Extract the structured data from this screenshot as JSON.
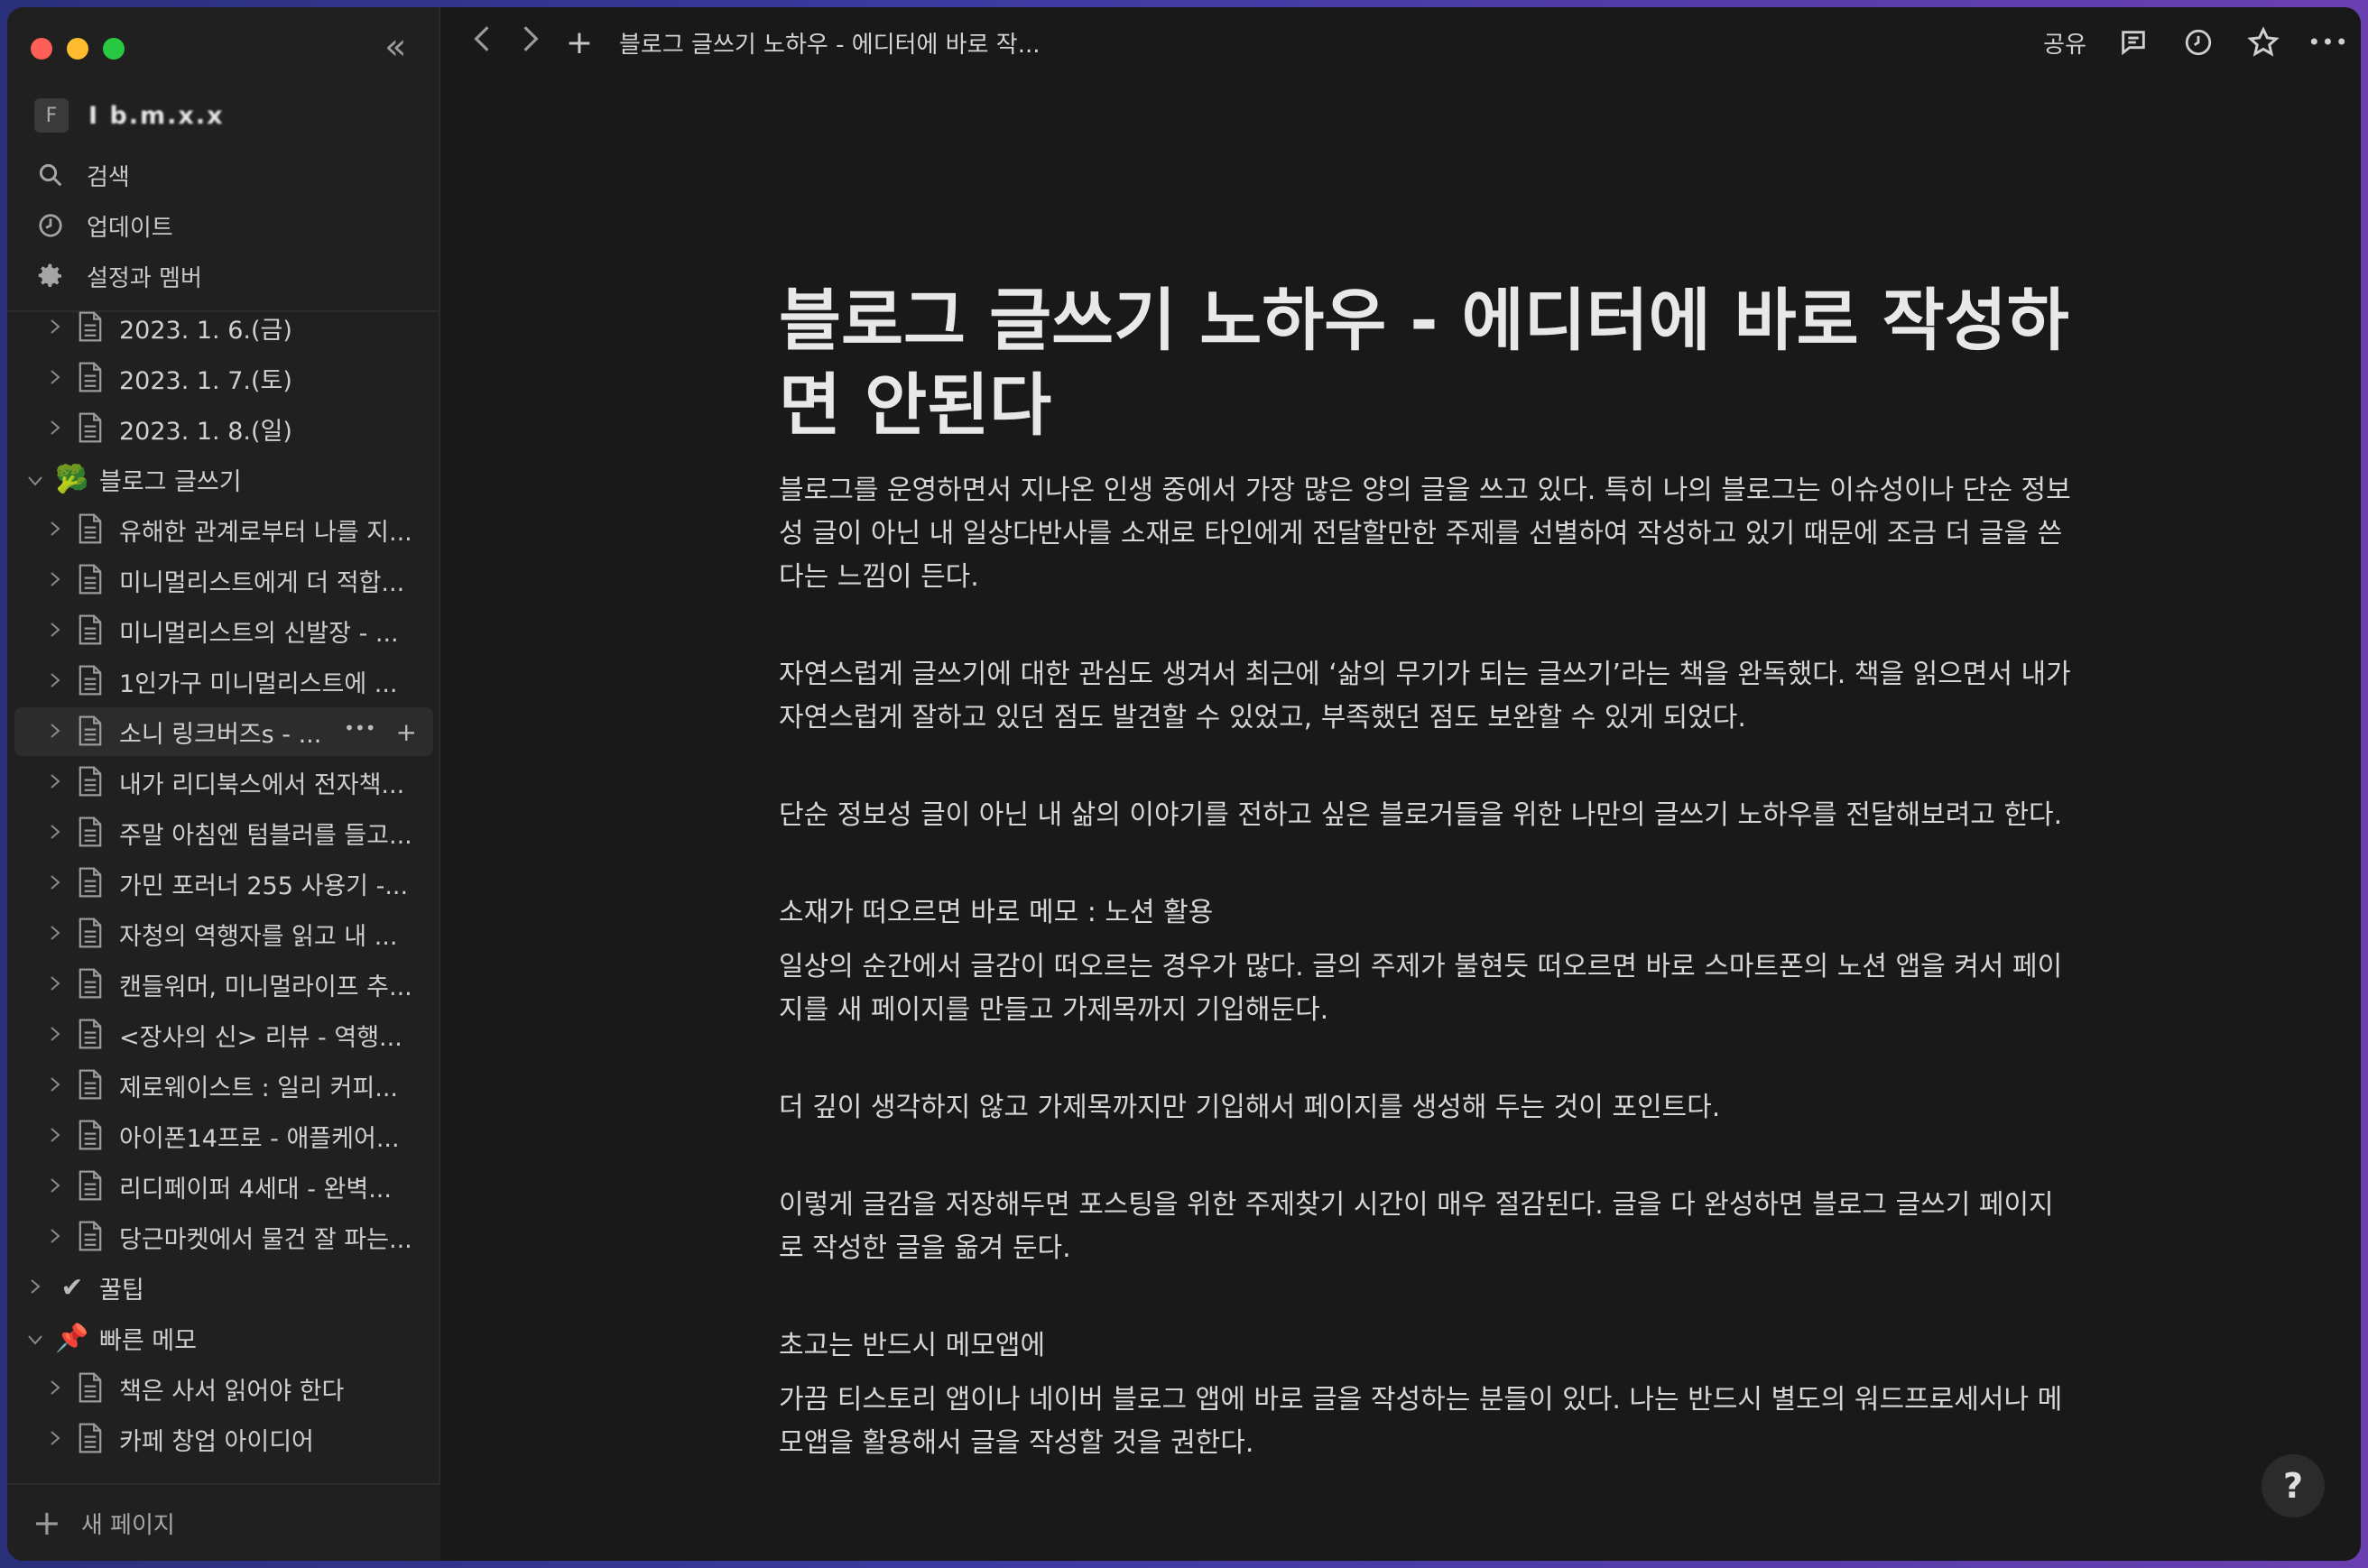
{
  "sidebar": {
    "workspace_initial": "F",
    "workspace_name": "I b.m.x.x",
    "collapse_glyph": "«",
    "system": [
      {
        "label": "검색",
        "icon": "search-icon"
      },
      {
        "label": "업데이트",
        "icon": "clock-icon"
      },
      {
        "label": "설정과 멤버",
        "icon": "gear-icon"
      }
    ],
    "tree": [
      {
        "label": "2023. 1. 6.(금)",
        "level": 1,
        "type": "doc"
      },
      {
        "label": "2023. 1. 7.(토)",
        "level": 1,
        "type": "doc"
      },
      {
        "label": "2023. 1. 8.(일)",
        "level": 1,
        "type": "doc"
      },
      {
        "label": "블로그 글쓰기",
        "level": 0,
        "type": "emoji",
        "emoji": "🥦",
        "expanded": true
      },
      {
        "label": "유해한 관계로부터 나를 지...",
        "level": 1,
        "type": "doc"
      },
      {
        "label": "미니멀리스트에게 더 적합...",
        "level": 1,
        "type": "doc"
      },
      {
        "label": "미니멀리스트의 신발장 - ...",
        "level": 1,
        "type": "doc"
      },
      {
        "label": "1인가구 미니멀리스트에 ...",
        "level": 1,
        "type": "doc"
      },
      {
        "label": "소니 링크버즈s - ...",
        "level": 1,
        "type": "doc",
        "selected": true
      },
      {
        "label": "내가 리디북스에서 전자책...",
        "level": 1,
        "type": "doc"
      },
      {
        "label": "주말 아침엔 텀블러를 들고...",
        "level": 1,
        "type": "doc"
      },
      {
        "label": "가민 포러너 255 사용기 -...",
        "level": 1,
        "type": "doc"
      },
      {
        "label": "자청의 역행자를 읽고 내 ...",
        "level": 1,
        "type": "doc"
      },
      {
        "label": "캔들워머, 미니멀라이프 추...",
        "level": 1,
        "type": "doc"
      },
      {
        "label": "<장사의 신> 리뷰 - 역행...",
        "level": 1,
        "type": "doc"
      },
      {
        "label": "제로웨이스트 : 일리 커피...",
        "level": 1,
        "type": "doc"
      },
      {
        "label": "아이폰14프로 - 애플케어...",
        "level": 1,
        "type": "doc"
      },
      {
        "label": "리디페이퍼 4세대 - 완벽...",
        "level": 1,
        "type": "doc"
      },
      {
        "label": "당근마켓에서 물건 잘 파는...",
        "level": 1,
        "type": "doc"
      },
      {
        "label": "꿀팁",
        "level": 0,
        "type": "emoji",
        "emoji": "✔",
        "expanded": false
      },
      {
        "label": "빠른 메모",
        "level": 0,
        "type": "emoji",
        "emoji": "📌",
        "expanded": true
      },
      {
        "label": "책은 사서 읽어야 한다",
        "level": 1,
        "type": "doc"
      },
      {
        "label": "카페 창업 아이디어",
        "level": 1,
        "type": "doc"
      }
    ],
    "row_actions": {
      "more": "•••",
      "add": "+"
    },
    "new_page_label": "새 페이지"
  },
  "topbar": {
    "back": "‹",
    "forward": "›",
    "add": "+",
    "breadcrumb": "블로그 글쓰기 노하우 - 에디터에 바로 작...",
    "share": "공유",
    "more": "•••"
  },
  "page": {
    "title": "블로그 글쓰기 노하우 - 에디터에 바로 작성하면 안된다",
    "blocks": [
      {
        "text": "블로그를 운영하면서 지나온 인생 중에서 가장 많은 양의 글을 쓰고 있다. 특히 나의 블로그는 이슈성이나 단순 정보성 글이 아닌 내 일상다반사를 소재로 타인에게 전달할만한 주제를 선별하여 작성하고 있기 때문에 조금 더 글을 쓴다는 느낌이 든다.",
        "top": 0
      },
      {
        "text": "자연스럽게 글쓰기에 대한 관심도 생겨서 최근에 ‘삶의 무기가 되는 글쓰기’라는 책을 완독했다. 책을 읽으면서 내가 자연스럽게 잘하고 있던 점도 발견할 수 있었고, 부족했던 점도 보완할 수 있게 되었다.",
        "top": 0
      },
      {
        "text": "단순 정보성 글이 아닌 내 삶의 이야기를 전하고 싶은 블로거들을 위한 나만의 글쓰기 노하우를 전달해보려고 한다.",
        "top": 0
      },
      {
        "text": "소재가 떠오르면 바로 메모 : 노션 활용",
        "top": 0
      },
      {
        "text": "일상의 순간에서 글감이 떠오르는 경우가 많다. 글의 주제가 불현듯 떠오르면 바로 스마트폰의 노션 앱을 켜서 페이지를 새 페이지를 만들고 가제목까지 기입해둔다.",
        "top": 0
      },
      {
        "text": "더 깊이 생각하지 않고 가제목까지만 기입해서 페이지를 생성해 두는 것이 포인트다.",
        "top": 0
      },
      {
        "text": "이렇게 글감을 저장해두면 포스팅을 위한 주제찾기 시간이 매우 절감된다. 글을 다 완성하면 블로그 글쓰기 페이지로 작성한 글을 옮겨 둔다.",
        "top": 0
      },
      {
        "text": "초고는 반드시 메모앱에",
        "top": 0
      },
      {
        "text": "가끔 티스토리 앱이나 네이버 블로그 앱에 바로 글을 작성하는 분들이 있다. 나는 반드시 별도의 워드프로세서나 메모앱을 활용해서 글을 작성할 것을 권한다.",
        "top": 0
      }
    ]
  },
  "help_label": "?"
}
